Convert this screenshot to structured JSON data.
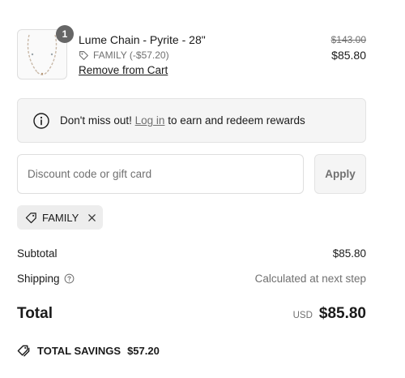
{
  "line_item": {
    "quantity": "1",
    "name": "Lume Chain - Pyrite - 28\"",
    "discount_label": "FAMILY (-$57.20)",
    "remove_label": "Remove from Cart",
    "original_price": "$143.00",
    "price": "$85.80"
  },
  "rewards": {
    "prefix": "Don't miss out!",
    "link": "Log in",
    "suffix": "to earn and redeem rewards"
  },
  "discount": {
    "placeholder": "Discount code or gift card",
    "apply_label": "Apply",
    "applied_code": "FAMILY"
  },
  "summary": {
    "subtotal_label": "Subtotal",
    "subtotal_value": "$85.80",
    "shipping_label": "Shipping",
    "shipping_value": "Calculated at next step",
    "total_label": "Total",
    "currency": "USD",
    "total_value": "$85.80",
    "savings_label": "TOTAL SAVINGS",
    "savings_value": "$57.20"
  },
  "icons": {
    "tag": "tag-icon",
    "info": "info-icon",
    "help": "help-circle-icon",
    "close": "close-icon",
    "tags": "tags-icon"
  },
  "colors": {
    "text": "#1a1a1a",
    "muted": "#707070",
    "panel": "#f5f5f5",
    "badge": "#666666"
  }
}
